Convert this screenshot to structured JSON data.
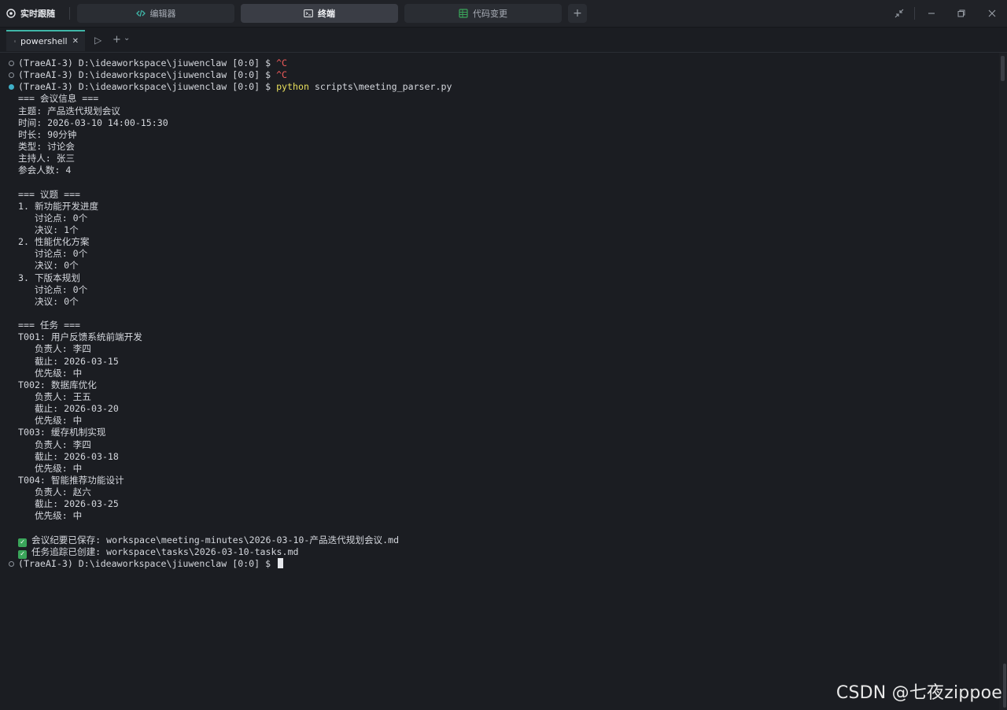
{
  "topbar": {
    "brand_label": "实时跟随",
    "tabs": [
      {
        "label": "编辑器",
        "icon": "code-icon"
      },
      {
        "label": "终端",
        "icon": "terminal-icon"
      },
      {
        "label": "代码变更",
        "icon": "diff-icon"
      }
    ],
    "add_tab_symbol": "+"
  },
  "terminal_tab": {
    "label": "powershell",
    "close_symbol": "✕",
    "run_symbol": "▷",
    "new_symbol": "+",
    "dropdown_symbol": "⌄"
  },
  "terminal": {
    "prompt": "(TraeAI-3) D:\\ideaworkspace\\jiuwenclaw [0:0] $ ",
    "cmd_interrupt": "^C",
    "cmd_python": "python",
    "cmd_args": " scripts\\meeting_parser.py",
    "output": [
      "=== 会议信息 ===",
      "主题: 产品迭代规划会议",
      "时间: 2026-03-10 14:00-15:30",
      "时长: 90分钟",
      "类型: 讨论会",
      "主持人: 张三",
      "参会人数: 4",
      "",
      "=== 议题 ===",
      "1. 新功能开发进度",
      "   讨论点: 0个",
      "   决议: 1个",
      "2. 性能优化方案",
      "   讨论点: 0个",
      "   决议: 0个",
      "3. 下版本规划",
      "   讨论点: 0个",
      "   决议: 0个",
      "",
      "=== 任务 ===",
      "T001: 用户反馈系统前端开发",
      "   负责人: 李四",
      "   截止: 2026-03-15",
      "   优先级: 中",
      "T002: 数据库优化",
      "   负责人: 王五",
      "   截止: 2026-03-20",
      "   优先级: 中",
      "T003: 缓存机制实现",
      "   负责人: 李四",
      "   截止: 2026-03-18",
      "   优先级: 中",
      "T004: 智能推荐功能设计",
      "   负责人: 赵六",
      "   截止: 2026-03-25",
      "   优先级: 中",
      ""
    ],
    "saved_minutes": "会议纪要已保存: workspace\\meeting-minutes\\2026-03-10-产品迭代规划会议.md",
    "created_tasks": "任务追踪已创建: workspace\\tasks\\2026-03-10-tasks.md"
  },
  "watermark": "CSDN @七夜zippoe",
  "colors": {
    "accent": "#3fb6a8",
    "error": "#f05a5a",
    "command": "#e8df5c",
    "success": "#3aa55a"
  }
}
